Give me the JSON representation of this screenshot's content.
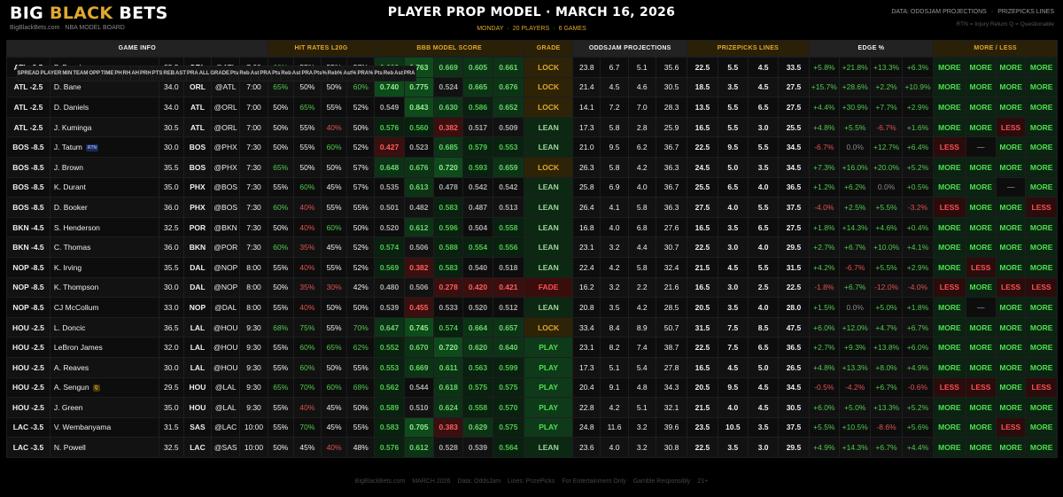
{
  "brand": {
    "big": "BIG",
    "black": "BLACK",
    "bets": "BETS",
    "site": "BigBlackBets.com",
    "board": "NBA MODEL BOARD"
  },
  "title": {
    "main": "PLAYER PROP MODEL",
    "dot": "·",
    "date": "MARCH 16, 2026"
  },
  "meta": {
    "day": "MONDAY",
    "sep1": "·",
    "players": "20 PLAYERS",
    "sep2": "·",
    "games": "6 GAMES"
  },
  "topright": {
    "src": "DATA: ODDSJAM PROJECTIONS",
    "sep": "·",
    "pp": "PRIZEPICKS LINES"
  },
  "legend": "RTN = Injury Return   Q = Questionable",
  "groups": [
    "GAME INFO",
    "HIT RATES  L20G",
    "BBB MODEL SCORE",
    "GRADE",
    "ODDSJAM PROJECTIONS",
    "PRIZEPICKS LINES",
    "EDGE %",
    "MORE / LESS"
  ],
  "columns": {
    "info": [
      "SPREAD",
      "PLAYER",
      "MIN",
      "TEAM",
      "OPP",
      "TIME"
    ],
    "hit": [
      "PH",
      "RH",
      "AH",
      "PRH"
    ],
    "model": [
      "PTS",
      "REB",
      "AST",
      "PRA",
      "ALL"
    ],
    "grade": [
      "GRADE"
    ],
    "oj": [
      "Pts",
      "Reb",
      "Ast",
      "PRA"
    ],
    "pp": [
      "Pts",
      "Reb",
      "Ast",
      "PRA"
    ],
    "edge": [
      "Pts%",
      "Reb%",
      "Ast%",
      "PRA%"
    ],
    "ml": [
      "Pts",
      "Reb",
      "Ast",
      "PRA"
    ]
  },
  "rows": [
    {
      "spread": "ATL -2.5",
      "player": "P. Banchero",
      "badge": "",
      "min": "35.5",
      "team": "ORL",
      "opp": "@ATL",
      "time": "7:00",
      "hit": [
        "60%",
        "55%",
        "55%",
        "57%"
      ],
      "model": [
        "0.609",
        "0.763",
        "0.669",
        "0.605",
        "0.661"
      ],
      "grade": "LOCK",
      "oj": [
        "23.8",
        "6.7",
        "5.1",
        "35.6"
      ],
      "pp": [
        "22.5",
        "5.5",
        "4.5",
        "33.5"
      ],
      "edge": [
        "+5.8%",
        "+21.8%",
        "+13.3%",
        "+6.3%"
      ],
      "ml": [
        "MORE",
        "MORE",
        "MORE",
        "MORE"
      ]
    },
    {
      "spread": "ATL -2.5",
      "player": "D. Bane",
      "badge": "",
      "min": "34.0",
      "team": "ORL",
      "opp": "@ATL",
      "time": "7:00",
      "hit": [
        "65%",
        "50%",
        "50%",
        "60%"
      ],
      "model": [
        "0.740",
        "0.775",
        "0.524",
        "0.665",
        "0.676"
      ],
      "grade": "LOCK",
      "oj": [
        "21.4",
        "4.5",
        "4.6",
        "30.5"
      ],
      "pp": [
        "18.5",
        "3.5",
        "4.5",
        "27.5"
      ],
      "edge": [
        "+15.7%",
        "+28.6%",
        "+2.2%",
        "+10.9%"
      ],
      "ml": [
        "MORE",
        "MORE",
        "MORE",
        "MORE"
      ]
    },
    {
      "spread": "ATL -2.5",
      "player": "D. Daniels",
      "badge": "",
      "min": "34.0",
      "team": "ATL",
      "opp": "@ORL",
      "time": "7:00",
      "hit": [
        "50%",
        "65%",
        "55%",
        "52%"
      ],
      "model": [
        "0.549",
        "0.843",
        "0.630",
        "0.586",
        "0.652"
      ],
      "grade": "LOCK",
      "oj": [
        "14.1",
        "7.2",
        "7.0",
        "28.3"
      ],
      "pp": [
        "13.5",
        "5.5",
        "6.5",
        "27.5"
      ],
      "edge": [
        "+4.4%",
        "+30.9%",
        "+7.7%",
        "+2.9%"
      ],
      "ml": [
        "MORE",
        "MORE",
        "MORE",
        "MORE"
      ]
    },
    {
      "spread": "ATL -2.5",
      "player": "J. Kuminga",
      "badge": "",
      "min": "30.5",
      "team": "ATL",
      "opp": "@ORL",
      "time": "7:00",
      "hit": [
        "50%",
        "55%",
        "40%",
        "50%"
      ],
      "model": [
        "0.576",
        "0.560",
        "0.382",
        "0.517",
        "0.509"
      ],
      "grade": "LEAN",
      "oj": [
        "17.3",
        "5.8",
        "2.8",
        "25.9"
      ],
      "pp": [
        "16.5",
        "5.5",
        "3.0",
        "25.5"
      ],
      "edge": [
        "+4.8%",
        "+5.5%",
        "-6.7%",
        "+1.6%"
      ],
      "ml": [
        "MORE",
        "MORE",
        "LESS",
        "MORE"
      ]
    },
    {
      "spread": "BOS -8.5",
      "player": "J. Tatum",
      "badge": "RTN",
      "min": "30.0",
      "team": "BOS",
      "opp": "@PHX",
      "time": "7:30",
      "hit": [
        "50%",
        "55%",
        "60%",
        "52%"
      ],
      "model": [
        "0.427",
        "0.523",
        "0.685",
        "0.579",
        "0.553"
      ],
      "grade": "LEAN",
      "oj": [
        "21.0",
        "9.5",
        "6.2",
        "36.7"
      ],
      "pp": [
        "22.5",
        "9.5",
        "5.5",
        "34.5"
      ],
      "edge": [
        "-6.7%",
        "0.0%",
        "+12.7%",
        "+6.4%"
      ],
      "ml": [
        "LESS",
        "—",
        "MORE",
        "MORE"
      ]
    },
    {
      "spread": "BOS -8.5",
      "player": "J. Brown",
      "badge": "",
      "min": "35.5",
      "team": "BOS",
      "opp": "@PHX",
      "time": "7:30",
      "hit": [
        "65%",
        "50%",
        "50%",
        "57%"
      ],
      "model": [
        "0.648",
        "0.676",
        "0.720",
        "0.593",
        "0.659"
      ],
      "grade": "LOCK",
      "oj": [
        "26.3",
        "5.8",
        "4.2",
        "36.3"
      ],
      "pp": [
        "24.5",
        "5.0",
        "3.5",
        "34.5"
      ],
      "edge": [
        "+7.3%",
        "+16.0%",
        "+20.0%",
        "+5.2%"
      ],
      "ml": [
        "MORE",
        "MORE",
        "MORE",
        "MORE"
      ]
    },
    {
      "spread": "BOS -8.5",
      "player": "K. Durant",
      "badge": "",
      "min": "35.0",
      "team": "PHX",
      "opp": "@BOS",
      "time": "7:30",
      "hit": [
        "55%",
        "60%",
        "45%",
        "57%"
      ],
      "model": [
        "0.535",
        "0.613",
        "0.478",
        "0.542",
        "0.542"
      ],
      "grade": "LEAN",
      "oj": [
        "25.8",
        "6.9",
        "4.0",
        "36.7"
      ],
      "pp": [
        "25.5",
        "6.5",
        "4.0",
        "36.5"
      ],
      "edge": [
        "+1.2%",
        "+6.2%",
        "0.0%",
        "+0.5%"
      ],
      "ml": [
        "MORE",
        "MORE",
        "—",
        "MORE"
      ]
    },
    {
      "spread": "BOS -8.5",
      "player": "D. Booker",
      "badge": "",
      "min": "36.0",
      "team": "PHX",
      "opp": "@BOS",
      "time": "7:30",
      "hit": [
        "60%",
        "40%",
        "55%",
        "55%"
      ],
      "model": [
        "0.501",
        "0.482",
        "0.583",
        "0.487",
        "0.513"
      ],
      "grade": "LEAN",
      "oj": [
        "26.4",
        "4.1",
        "5.8",
        "36.3"
      ],
      "pp": [
        "27.5",
        "4.0",
        "5.5",
        "37.5"
      ],
      "edge": [
        "-4.0%",
        "+2.5%",
        "+5.5%",
        "-3.2%"
      ],
      "ml": [
        "LESS",
        "MORE",
        "MORE",
        "LESS"
      ]
    },
    {
      "spread": "BKN -4.5",
      "player": "S. Henderson",
      "badge": "",
      "min": "32.5",
      "team": "POR",
      "opp": "@BKN",
      "time": "7:30",
      "hit": [
        "50%",
        "40%",
        "60%",
        "50%"
      ],
      "model": [
        "0.520",
        "0.612",
        "0.596",
        "0.504",
        "0.558"
      ],
      "grade": "LEAN",
      "oj": [
        "16.8",
        "4.0",
        "6.8",
        "27.6"
      ],
      "pp": [
        "16.5",
        "3.5",
        "6.5",
        "27.5"
      ],
      "edge": [
        "+1.8%",
        "+14.3%",
        "+4.6%",
        "+0.4%"
      ],
      "ml": [
        "MORE",
        "MORE",
        "MORE",
        "MORE"
      ]
    },
    {
      "spread": "BKN -4.5",
      "player": "C. Thomas",
      "badge": "",
      "min": "36.0",
      "team": "BKN",
      "opp": "@POR",
      "time": "7:30",
      "hit": [
        "60%",
        "35%",
        "45%",
        "52%"
      ],
      "model": [
        "0.574",
        "0.506",
        "0.588",
        "0.554",
        "0.556"
      ],
      "grade": "LEAN",
      "oj": [
        "23.1",
        "3.2",
        "4.4",
        "30.7"
      ],
      "pp": [
        "22.5",
        "3.0",
        "4.0",
        "29.5"
      ],
      "edge": [
        "+2.7%",
        "+6.7%",
        "+10.0%",
        "+4.1%"
      ],
      "ml": [
        "MORE",
        "MORE",
        "MORE",
        "MORE"
      ]
    },
    {
      "spread": "NOP -8.5",
      "player": "K. Irving",
      "badge": "",
      "min": "35.5",
      "team": "DAL",
      "opp": "@NOP",
      "time": "8:00",
      "hit": [
        "55%",
        "40%",
        "55%",
        "52%"
      ],
      "model": [
        "0.569",
        "0.382",
        "0.583",
        "0.540",
        "0.518"
      ],
      "grade": "LEAN",
      "oj": [
        "22.4",
        "4.2",
        "5.8",
        "32.4"
      ],
      "pp": [
        "21.5",
        "4.5",
        "5.5",
        "31.5"
      ],
      "edge": [
        "+4.2%",
        "-6.7%",
        "+5.5%",
        "+2.9%"
      ],
      "ml": [
        "MORE",
        "LESS",
        "MORE",
        "MORE"
      ]
    },
    {
      "spread": "NOP -8.5",
      "player": "K. Thompson",
      "badge": "",
      "min": "30.0",
      "team": "DAL",
      "opp": "@NOP",
      "time": "8:00",
      "hit": [
        "50%",
        "35%",
        "30%",
        "42%"
      ],
      "model": [
        "0.480",
        "0.506",
        "0.278",
        "0.420",
        "0.421"
      ],
      "grade": "FADE",
      "oj": [
        "16.2",
        "3.2",
        "2.2",
        "21.6"
      ],
      "pp": [
        "16.5",
        "3.0",
        "2.5",
        "22.5"
      ],
      "edge": [
        "-1.8%",
        "+6.7%",
        "-12.0%",
        "-4.0%"
      ],
      "ml": [
        "LESS",
        "MORE",
        "LESS",
        "LESS"
      ]
    },
    {
      "spread": "NOP -8.5",
      "player": "CJ McCollum",
      "badge": "",
      "min": "33.0",
      "team": "NOP",
      "opp": "@DAL",
      "time": "8:00",
      "hit": [
        "55%",
        "40%",
        "50%",
        "50%"
      ],
      "model": [
        "0.539",
        "0.455",
        "0.533",
        "0.520",
        "0.512"
      ],
      "grade": "LEAN",
      "oj": [
        "20.8",
        "3.5",
        "4.2",
        "28.5"
      ],
      "pp": [
        "20.5",
        "3.5",
        "4.0",
        "28.0"
      ],
      "edge": [
        "+1.5%",
        "0.0%",
        "+5.0%",
        "+1.8%"
      ],
      "ml": [
        "MORE",
        "—",
        "MORE",
        "MORE"
      ]
    },
    {
      "spread": "HOU -2.5",
      "player": "L. Doncic",
      "badge": "",
      "min": "36.5",
      "team": "LAL",
      "opp": "@HOU",
      "time": "9:30",
      "hit": [
        "68%",
        "75%",
        "55%",
        "70%"
      ],
      "model": [
        "0.647",
        "0.745",
        "0.574",
        "0.664",
        "0.657"
      ],
      "grade": "LOCK",
      "oj": [
        "33.4",
        "8.4",
        "8.9",
        "50.7"
      ],
      "pp": [
        "31.5",
        "7.5",
        "8.5",
        "47.5"
      ],
      "edge": [
        "+6.0%",
        "+12.0%",
        "+4.7%",
        "+6.7%"
      ],
      "ml": [
        "MORE",
        "MORE",
        "MORE",
        "MORE"
      ]
    },
    {
      "spread": "HOU -2.5",
      "player": "LeBron James",
      "badge": "",
      "min": "32.0",
      "team": "LAL",
      "opp": "@HOU",
      "time": "9:30",
      "hit": [
        "55%",
        "60%",
        "65%",
        "62%"
      ],
      "model": [
        "0.552",
        "0.670",
        "0.720",
        "0.620",
        "0.640"
      ],
      "grade": "PLAY",
      "oj": [
        "23.1",
        "8.2",
        "7.4",
        "38.7"
      ],
      "pp": [
        "22.5",
        "7.5",
        "6.5",
        "36.5"
      ],
      "edge": [
        "+2.7%",
        "+9.3%",
        "+13.8%",
        "+6.0%"
      ],
      "ml": [
        "MORE",
        "MORE",
        "MORE",
        "MORE"
      ]
    },
    {
      "spread": "HOU -2.5",
      "player": "A. Reaves",
      "badge": "",
      "min": "30.0",
      "team": "LAL",
      "opp": "@HOU",
      "time": "9:30",
      "hit": [
        "55%",
        "60%",
        "50%",
        "55%"
      ],
      "model": [
        "0.553",
        "0.669",
        "0.611",
        "0.563",
        "0.599"
      ],
      "grade": "PLAY",
      "oj": [
        "17.3",
        "5.1",
        "5.4",
        "27.8"
      ],
      "pp": [
        "16.5",
        "4.5",
        "5.0",
        "26.5"
      ],
      "edge": [
        "+4.8%",
        "+13.3%",
        "+8.0%",
        "+4.9%"
      ],
      "ml": [
        "MORE",
        "MORE",
        "MORE",
        "MORE"
      ]
    },
    {
      "spread": "HOU -2.5",
      "player": "A. Sengun",
      "badge": "Q",
      "min": "29.5",
      "team": "HOU",
      "opp": "@LAL",
      "time": "9:30",
      "hit": [
        "65%",
        "70%",
        "60%",
        "68%"
      ],
      "model": [
        "0.562",
        "0.544",
        "0.618",
        "0.575",
        "0.575"
      ],
      "grade": "PLAY",
      "oj": [
        "20.4",
        "9.1",
        "4.8",
        "34.3"
      ],
      "pp": [
        "20.5",
        "9.5",
        "4.5",
        "34.5"
      ],
      "edge": [
        "-0.5%",
        "-4.2%",
        "+6.7%",
        "-0.6%"
      ],
      "ml": [
        "LESS",
        "LESS",
        "MORE",
        "LESS"
      ]
    },
    {
      "spread": "HOU -2.5",
      "player": "J. Green",
      "badge": "",
      "min": "35.0",
      "team": "HOU",
      "opp": "@LAL",
      "time": "9:30",
      "hit": [
        "55%",
        "40%",
        "45%",
        "50%"
      ],
      "model": [
        "0.589",
        "0.510",
        "0.624",
        "0.558",
        "0.570"
      ],
      "grade": "PLAY",
      "oj": [
        "22.8",
        "4.2",
        "5.1",
        "32.1"
      ],
      "pp": [
        "21.5",
        "4.0",
        "4.5",
        "30.5"
      ],
      "edge": [
        "+6.0%",
        "+5.0%",
        "+13.3%",
        "+5.2%"
      ],
      "ml": [
        "MORE",
        "MORE",
        "MORE",
        "MORE"
      ]
    },
    {
      "spread": "LAC -3.5",
      "player": "V. Wembanyama",
      "badge": "",
      "min": "31.5",
      "team": "SAS",
      "opp": "@LAC",
      "time": "10:00",
      "hit": [
        "55%",
        "70%",
        "45%",
        "55%"
      ],
      "model": [
        "0.583",
        "0.705",
        "0.383",
        "0.629",
        "0.575"
      ],
      "grade": "PLAY",
      "oj": [
        "24.8",
        "11.6",
        "3.2",
        "39.6"
      ],
      "pp": [
        "23.5",
        "10.5",
        "3.5",
        "37.5"
      ],
      "edge": [
        "+5.5%",
        "+10.5%",
        "-8.6%",
        "+5.6%"
      ],
      "ml": [
        "MORE",
        "MORE",
        "LESS",
        "MORE"
      ]
    },
    {
      "spread": "LAC -3.5",
      "player": "N. Powell",
      "badge": "",
      "min": "32.5",
      "team": "LAC",
      "opp": "@SAS",
      "time": "10:00",
      "hit": [
        "50%",
        "45%",
        "40%",
        "48%"
      ],
      "model": [
        "0.576",
        "0.612",
        "0.528",
        "0.539",
        "0.564"
      ],
      "grade": "LEAN",
      "oj": [
        "23.6",
        "4.0",
        "3.2",
        "30.8"
      ],
      "pp": [
        "22.5",
        "3.5",
        "3.0",
        "29.5"
      ],
      "edge": [
        "+4.9%",
        "+14.3%",
        "+6.7%",
        "+4.4%"
      ],
      "ml": [
        "MORE",
        "MORE",
        "MORE",
        "MORE"
      ]
    }
  ],
  "footer": [
    "BigBlackBets.com",
    "MARCH 2026",
    "Data: OddsJam",
    "Lines: PrizePicks",
    "For Entertainment Only",
    "Gamble Responsibly",
    "21+"
  ]
}
